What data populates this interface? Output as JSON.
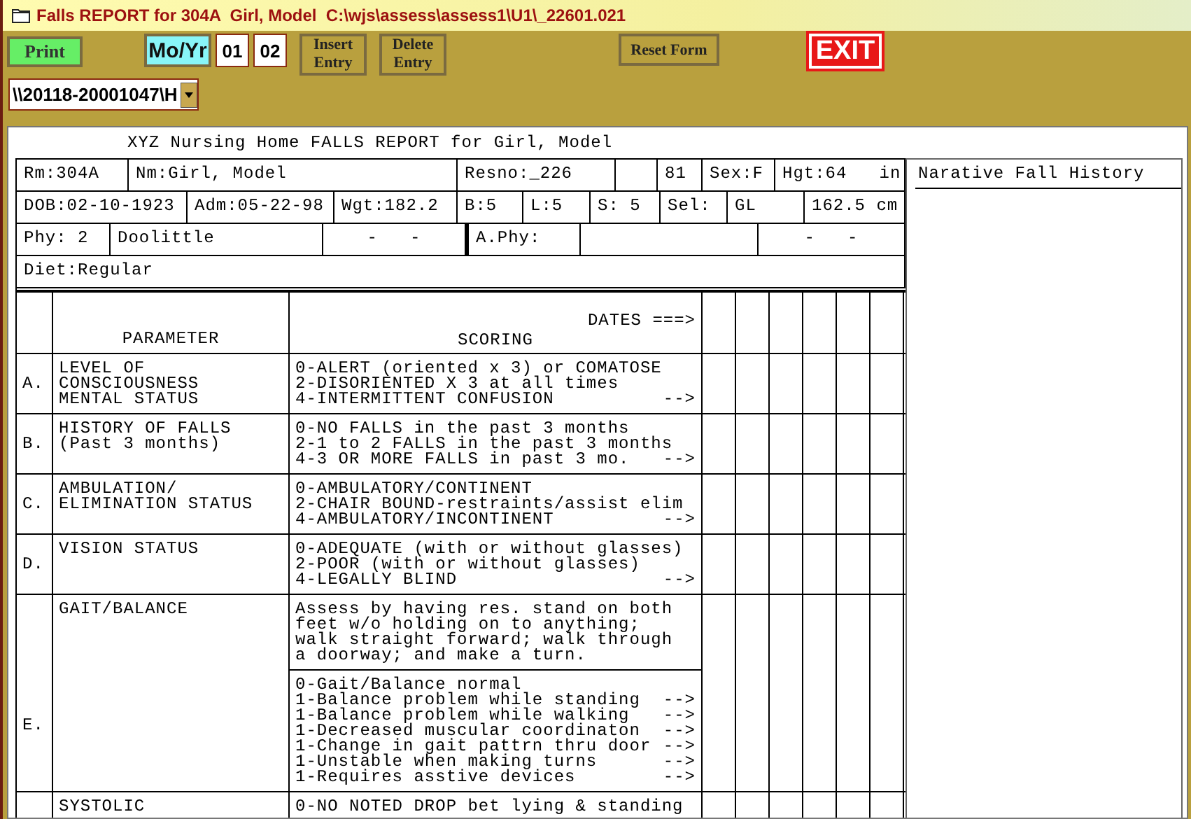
{
  "window": {
    "title": "Falls REPORT for 304A  Girl, Model  C:\\wjs\\assess\\assess1\\U1\\_22601.021"
  },
  "toolbar": {
    "print": "Print",
    "period_label": "Mo/Yr",
    "month": "01",
    "year": "02",
    "insert": "Insert Entry",
    "delete": "Delete Entry",
    "reset": "Reset Form",
    "exit": "EXIT"
  },
  "path_dropdown": {
    "value": "\\\\20118-20001047\\H"
  },
  "report": {
    "title": "XYZ Nursing Home FALLS REPORT for Girl, Model",
    "info_rows": [
      [
        "Rm:304A",
        "Nm:Girl, Model",
        "Resno:_226",
        "81",
        "Sex:F",
        "Hgt:64   in"
      ],
      [
        "DOB:02-10-1923",
        "Adm:05-22-98",
        "Wgt:182.2",
        "B:5",
        "L:5",
        "S: 5",
        "Sel:",
        "GL",
        "162.5 cm"
      ],
      [
        "Phy: 2",
        "Doolittle",
        "-   -",
        "A.Phy:",
        "-   -"
      ],
      [
        "Diet:Regular"
      ]
    ],
    "narrative_title": "Narative Fall History",
    "table": {
      "columns": [
        "PARAMETER",
        "SCORING"
      ],
      "dates_label": "DATES ===>",
      "rows": [
        {
          "letter": "A.",
          "parameter": [
            "LEVEL OF",
            "CONSCIOUSNESS",
            "MENTAL STATUS"
          ],
          "scoring": [
            [
              {
                "text": "0-ALERT (oriented x 3) or COMATOSE"
              },
              {
                "text": "2-DISORIENTED X 3 at all times"
              },
              {
                "text": "4-INTERMITTENT CONFUSION",
                "arrow": "-->"
              }
            ]
          ]
        },
        {
          "letter": "B.",
          "parameter": [
            "HISTORY OF FALLS",
            "(Past 3 months)"
          ],
          "scoring": [
            [
              {
                "text": "0-NO FALLS in the past 3 months"
              },
              {
                "text": "2-1 to 2 FALLS in the past 3 months"
              },
              {
                "text": "4-3 OR MORE FALLS in past 3 mo.",
                "arrow": "-->"
              }
            ]
          ]
        },
        {
          "letter": "C.",
          "parameter": [
            "AMBULATION/",
            "ELIMINATION STATUS"
          ],
          "scoring": [
            [
              {
                "text": "0-AMBULATORY/CONTINENT"
              },
              {
                "text": "2-CHAIR BOUND-restraints/assist elim"
              },
              {
                "text": "4-AMBULATORY/INCONTINENT",
                "arrow": "-->"
              }
            ]
          ]
        },
        {
          "letter": "D.",
          "parameter": [
            "VISION STATUS"
          ],
          "scoring": [
            [
              {
                "text": "0-ADEQUATE (with or without glasses)"
              },
              {
                "text": "2-POOR (with or without glasses)"
              },
              {
                "text": "4-LEGALLY BLIND",
                "arrow": "-->"
              }
            ]
          ]
        },
        {
          "letter": "E.",
          "parameter": [
            "GAIT/BALANCE"
          ],
          "scoring": [
            [
              {
                "text": "Assess by having res. stand on both"
              },
              {
                "text": "feet w/o holding on to anything;"
              },
              {
                "text": "walk straight forward; walk through"
              },
              {
                "text": "a doorway; and make a turn."
              }
            ],
            [
              {
                "text": "0-Gait/Balance normal"
              },
              {
                "text": "1-Balance problem while standing",
                "arrow": "-->"
              },
              {
                "text": "1-Balance problem while walking",
                "arrow": "-->"
              },
              {
                "text": "1-Decreased muscular coordinaton",
                "arrow": "-->"
              },
              {
                "text": "1-Change in gait pattrn thru door",
                "arrow": "-->"
              },
              {
                "text": "1-Unstable when making turns",
                "arrow": "-->"
              },
              {
                "text": "1-Requires asstive devices",
                "arrow": "-->"
              }
            ]
          ]
        },
        {
          "parameter": [
            "SYSTOLIC"
          ],
          "scoring": [
            [
              {
                "text": "0-NO NOTED DROP bet lying & standing"
              }
            ]
          ]
        }
      ]
    }
  }
}
